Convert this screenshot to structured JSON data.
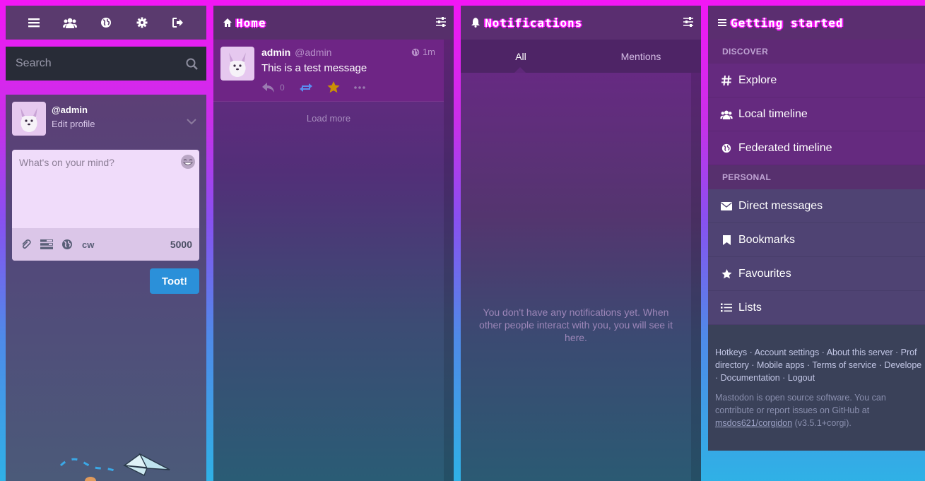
{
  "nav": {
    "icons": [
      "menu-icon",
      "users-icon",
      "globe-icon",
      "gear-icon",
      "logout-icon"
    ]
  },
  "search": {
    "placeholder": "Search"
  },
  "profile": {
    "handle": "@admin",
    "edit_label": "Edit profile"
  },
  "compose": {
    "placeholder": "What's on your mind?",
    "cw_label": "cw",
    "char_count": "5000",
    "submit_label": "Toot!"
  },
  "home": {
    "title": "Home",
    "status": {
      "display_name": "admin",
      "acct": "@admin",
      "time": "1m",
      "content": "This is a test message",
      "reply_count": "0"
    },
    "load_more": "Load more"
  },
  "notifications": {
    "title": "Notifications",
    "tabs": [
      "All",
      "Mentions"
    ],
    "empty_message": "You don't have any notifications yet. When other people interact with you, you will see it here."
  },
  "getting_started": {
    "title": "Getting started",
    "discover_label": "DISCOVER",
    "personal_label": "PERSONAL",
    "discover_items": [
      "Explore",
      "Local timeline",
      "Federated timeline"
    ],
    "personal_items": [
      "Direct messages",
      "Bookmarks",
      "Favourites",
      "Lists"
    ],
    "footer_links_line1": "Hotkeys · Account settings · About this server · Prof",
    "footer_links_line2": "directory · Mobile apps · Terms of service · Develope",
    "footer_links_line3": "· Documentation · Logout",
    "about_text": "Mastodon is open source software. You can contribute or report issues on GitHub at",
    "repo_link": "msdos621/corgidon",
    "version": "(v3.5.1+corgi)."
  },
  "colors": {
    "accent": "#f316f5",
    "toot_button": "#2b90d9",
    "reblog": "#5a8df0",
    "favourite": "#ca8f04"
  }
}
